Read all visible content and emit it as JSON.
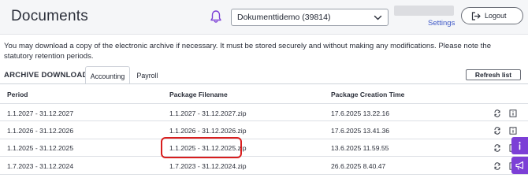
{
  "header": {
    "title": "Documents",
    "company_select": {
      "value": "Dokumenttidemo (39814)"
    },
    "settings_label": "Settings",
    "logout_label": "Logout"
  },
  "notice": "You may download a copy of the electronic archive if necessary. It must be stored securely and without making any modifications. Please note the statutory retention periods.",
  "archive": {
    "section_title": "ARCHIVE DOWNLOAD",
    "tabs": [
      {
        "label": "Accounting",
        "active": true
      },
      {
        "label": "Payroll",
        "active": false
      }
    ],
    "refresh_label": "Refresh list"
  },
  "table": {
    "columns": [
      "Period",
      "Package Filename",
      "Package Creation Time"
    ],
    "rows": [
      {
        "period": "1.1.2027 - 31.12.2027",
        "filename": "1.1.2027 - 31.12.2027.zip",
        "created": "17.6.2025 13.22.16"
      },
      {
        "period": "1.1.2026 - 31.12.2026",
        "filename": "1.1.2026 - 31.12.2026.zip",
        "created": "17.6.2025 13.41.36"
      },
      {
        "period": "1.1.2025 - 31.12.2025",
        "filename": "1.1.2025 - 31.12.2025.zip",
        "created": "13.6.2025 11.59.55"
      },
      {
        "period": "1.7.2023 - 31.12.2024",
        "filename": "1.7.2023 - 31.12.2024.zip",
        "created": "26.6.2025 8.40.47"
      }
    ],
    "row_actions": [
      "regenerate-icon",
      "info-icon"
    ]
  },
  "highlighted_row": 2,
  "side_buttons": [
    "info-icon",
    "megaphone-icon"
  ],
  "colors": {
    "accent": "#7c3fd6",
    "highlight": "#d81e1e",
    "link": "#3d57c6"
  }
}
